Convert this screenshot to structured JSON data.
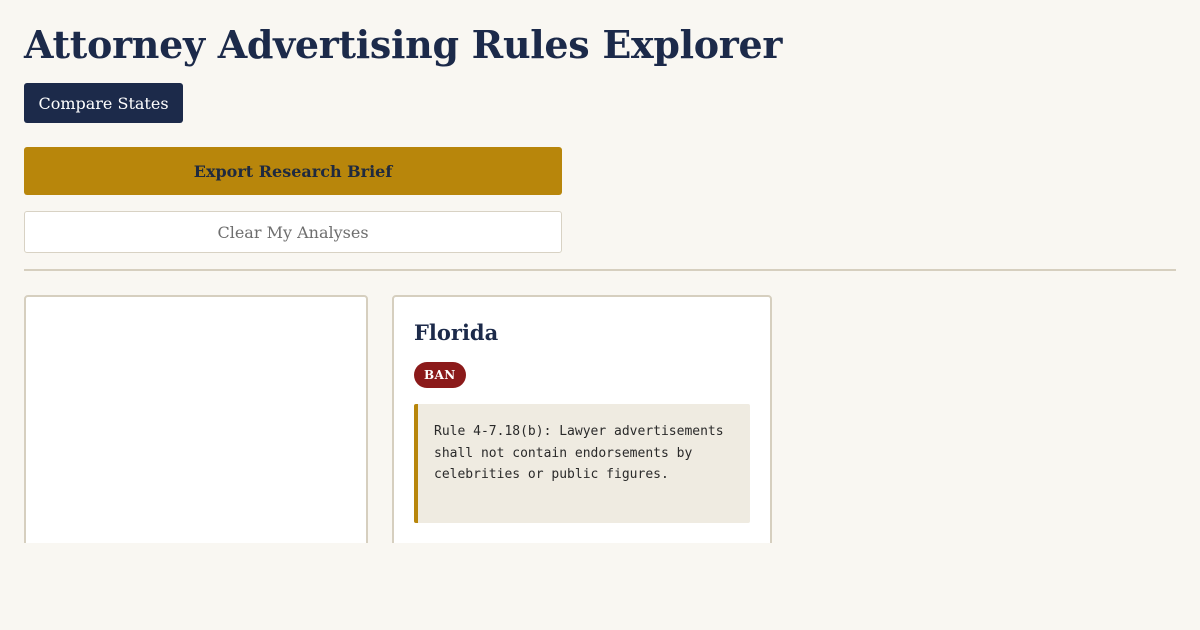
{
  "header": {
    "title": "Attorney Advertising Rules Explorer"
  },
  "toolbar": {
    "compare_label": "Compare States",
    "export_label": "Export Research Brief",
    "clear_label": "Clear My Analyses"
  },
  "cards": [
    {
      "state": "",
      "status": "",
      "rule": ""
    },
    {
      "state": "Florida",
      "status": "BAN",
      "rule": "Rule 4-7.18(b): Lawyer advertisements shall not contain endorsements by celebrities or public figures."
    }
  ],
  "colors": {
    "primary": "#1c2a4a",
    "accent": "#b8860b",
    "ban": "#8b1a1a",
    "background": "#f9f7f2"
  }
}
